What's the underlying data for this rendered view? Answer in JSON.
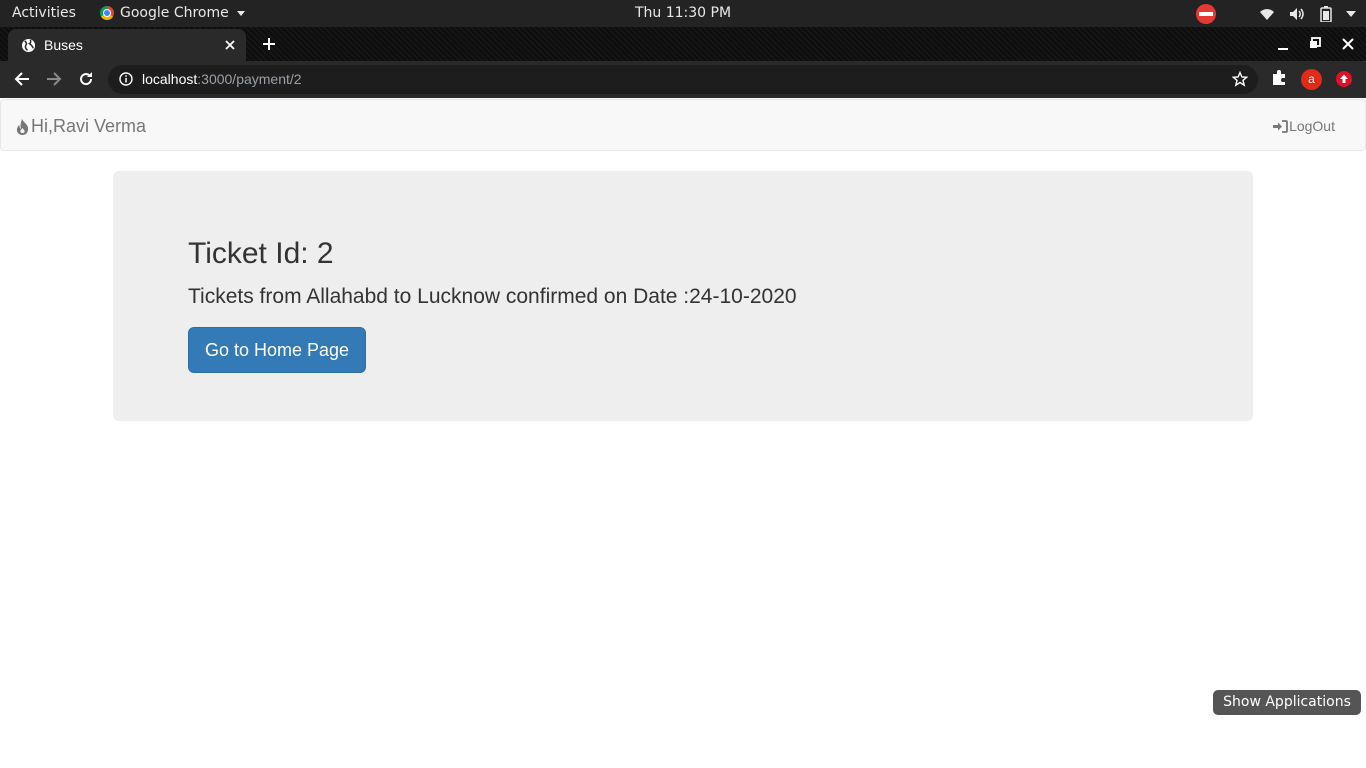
{
  "topbar": {
    "activities": "Activities",
    "app_name": "Google Chrome",
    "clock": "Thu 11:30 PM"
  },
  "browser": {
    "tab_title": "Buses",
    "url_host": "localhost",
    "url_rest": ":3000/payment/2",
    "extension_a_label": "a"
  },
  "navbar": {
    "brand": "Hi,Ravi Verma",
    "logout": "LogOut"
  },
  "main": {
    "ticket_heading": "Ticket Id: 2",
    "ticket_message": "Tickets from Allahabd to Lucknow confirmed on Date :24-10-2020",
    "home_button": "Go to Home Page"
  },
  "tooltip": "Show Applications",
  "colors": {
    "primary_button": "#337ab7",
    "jumbotron_bg": "#eeeeee",
    "navbar_bg": "#f8f8f8"
  }
}
